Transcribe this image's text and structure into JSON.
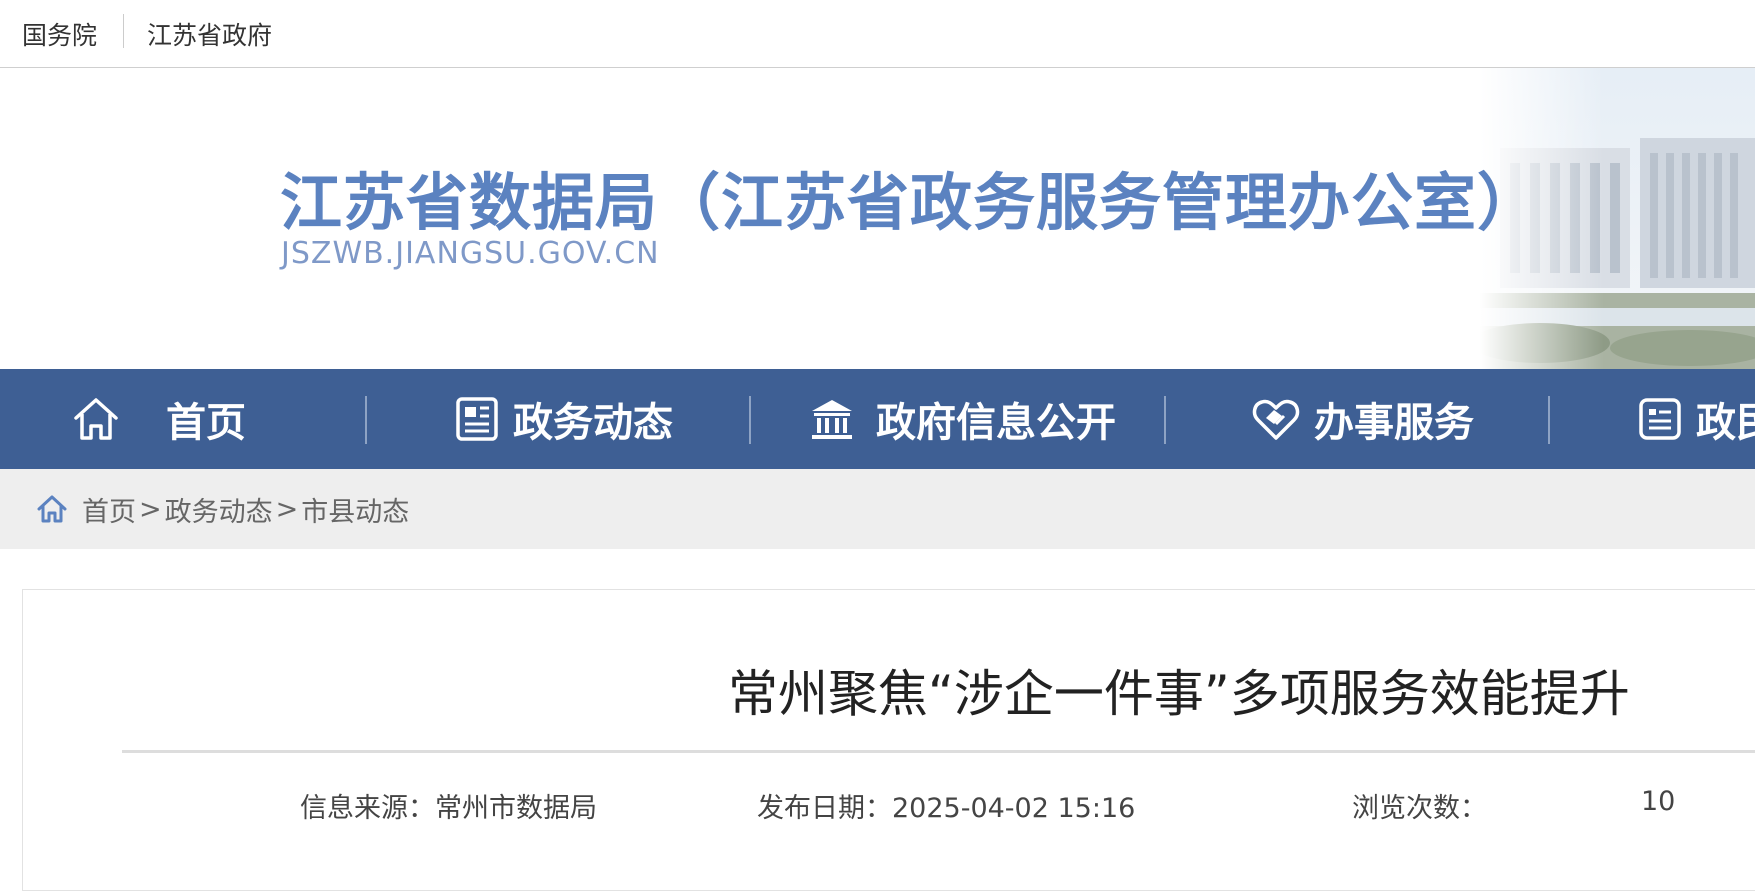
{
  "topbar": {
    "links": [
      "国务院",
      "江苏省政府"
    ]
  },
  "banner": {
    "title": "江苏省数据局（江苏省政务服务管理办公室）",
    "domain": "JSZWB.JIANGSU.GOV.CN"
  },
  "nav": {
    "items": [
      {
        "label": "首页",
        "icon": "home-icon"
      },
      {
        "label": "政务动态",
        "icon": "news-icon"
      },
      {
        "label": "政府信息公开",
        "icon": "government-building-icon"
      },
      {
        "label": "办事服务",
        "icon": "handshake-heart-icon"
      },
      {
        "label": "政民",
        "icon": "list-document-icon"
      }
    ]
  },
  "breadcrumb": {
    "items": [
      "首页",
      "政务动态",
      "市县动态"
    ],
    "separator": ">"
  },
  "article": {
    "title": "常州聚焦“涉企一件事”多项服务效能提升",
    "source_label": "信息来源：",
    "source": "常州市数据局",
    "date_label": "发布日期：",
    "date": "2025-04-02 15:16",
    "views_label": "浏览次数：",
    "views": "10"
  },
  "colors": {
    "nav_bg": "#3e5f94",
    "title_blue": "#5b82c0",
    "breadcrumb_bg": "#eeeeee"
  }
}
